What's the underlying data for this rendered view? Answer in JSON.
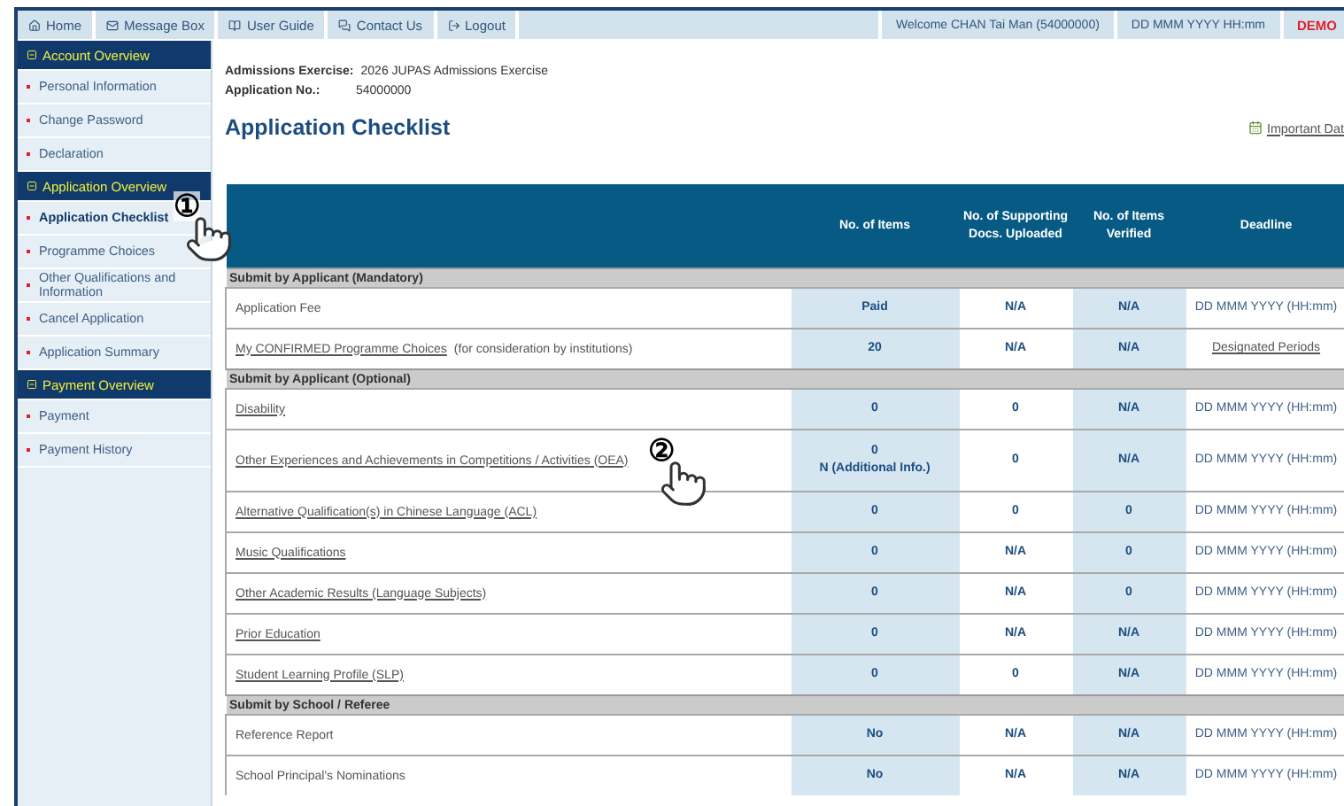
{
  "top_nav": {
    "items": [
      {
        "label": "Home",
        "kind": "home"
      },
      {
        "label": "Message Box",
        "kind": "mail"
      },
      {
        "label": "User Guide",
        "kind": "book"
      },
      {
        "label": "Contact Us",
        "kind": "chat"
      },
      {
        "label": "Logout",
        "kind": "logout"
      }
    ],
    "welcome": "Welcome CHAN Tai Man (54000000)",
    "datetime": "DD MMM YYYY HH:mm",
    "mode": "DEMO"
  },
  "sidebar": {
    "sections": [
      {
        "title": "Account Overview",
        "items": [
          {
            "label": "Personal Information",
            "selected": false
          },
          {
            "label": "Change Password",
            "selected": false
          },
          {
            "label": "Declaration",
            "selected": false
          }
        ]
      },
      {
        "title": "Application Overview",
        "items": [
          {
            "label": "Application Checklist",
            "selected": true
          },
          {
            "label": "Programme Choices",
            "selected": false
          },
          {
            "label": "Other Qualifications and Information",
            "selected": false
          },
          {
            "label": "Cancel Application",
            "selected": false
          },
          {
            "label": "Application Summary",
            "selected": false
          }
        ]
      },
      {
        "title": "Payment Overview",
        "items": [
          {
            "label": "Payment",
            "selected": false
          },
          {
            "label": "Payment History",
            "selected": false
          }
        ]
      }
    ]
  },
  "info": [
    {
      "label": "Admissions Exercise:",
      "value": "2026 JUPAS Admissions Exercise"
    },
    {
      "label": "Application No.:",
      "value": "54000000"
    }
  ],
  "page_title": "Application Checklist",
  "important_dates_link": "Important Dat",
  "table": {
    "columns": [
      "No. of Items",
      "No. of Supporting Docs. Uploaded",
      "No. of Items Verified",
      "Deadline"
    ],
    "groups": [
      {
        "title": "Submit by Applicant (Mandatory)",
        "rows": [
          {
            "label": "Application Fee",
            "link": false,
            "items": [
              "Paid"
            ],
            "docs": "N/A",
            "verified": "N/A",
            "deadline": "DD MMM YYYY (HH:mm)",
            "deadline_link": false
          },
          {
            "label": "My CONFIRMED Programme Choices",
            "note": "(for consideration by institutions)",
            "link": true,
            "items": [
              "20"
            ],
            "docs": "N/A",
            "verified": "N/A",
            "deadline": "Designated Periods",
            "deadline_link": true
          }
        ]
      },
      {
        "title": "Submit by Applicant (Optional)",
        "rows": [
          {
            "label": "Disability",
            "link": true,
            "items": [
              "0"
            ],
            "docs": "0",
            "verified": "N/A",
            "deadline": "DD MMM YYYY (HH:mm)",
            "deadline_link": false
          },
          {
            "label": "Other Experiences and Achievements in Competitions / Activities (OEA)",
            "link": true,
            "items": [
              "0",
              "N (Additional Info.)"
            ],
            "docs": "0",
            "verified": "N/A",
            "deadline": "DD MMM YYYY (HH:mm)",
            "deadline_link": false
          },
          {
            "label": "Alternative Qualification(s) in Chinese Language (ACL)",
            "link": true,
            "items": [
              "0"
            ],
            "docs": "0",
            "verified": "0",
            "deadline": "DD MMM YYYY (HH:mm)",
            "deadline_link": false
          },
          {
            "label": "Music Qualifications",
            "link": true,
            "items": [
              "0"
            ],
            "docs": "N/A",
            "verified": "0",
            "deadline": "DD MMM YYYY (HH:mm)",
            "deadline_link": false
          },
          {
            "label": "Other Academic Results (Language Subjects)",
            "link": true,
            "items": [
              "0"
            ],
            "docs": "N/A",
            "verified": "0",
            "deadline": "DD MMM YYYY (HH:mm)",
            "deadline_link": false
          },
          {
            "label": "Prior Education",
            "link": true,
            "items": [
              "0"
            ],
            "docs": "N/A",
            "verified": "N/A",
            "deadline": "DD MMM YYYY (HH:mm)",
            "deadline_link": false
          },
          {
            "label": "Student Learning Profile (SLP)",
            "link": true,
            "items": [
              "0"
            ],
            "docs": "0",
            "verified": "N/A",
            "deadline": "DD MMM YYYY (HH:mm)",
            "deadline_link": false
          }
        ]
      },
      {
        "title": "Submit by School / Referee",
        "rows": [
          {
            "label": "Reference Report",
            "link": false,
            "items": [
              "No"
            ],
            "docs": "N/A",
            "verified": "N/A",
            "deadline": "DD MMM YYYY (HH:mm)",
            "deadline_link": false
          },
          {
            "label": "School Principal's Nominations",
            "link": false,
            "items": [
              "No"
            ],
            "docs": "N/A",
            "verified": "N/A",
            "deadline": "DD MMM YYYY (HH:mm)",
            "deadline_link": false
          }
        ]
      }
    ]
  },
  "annotations": [
    {
      "number": "①"
    },
    {
      "number": "②"
    }
  ]
}
